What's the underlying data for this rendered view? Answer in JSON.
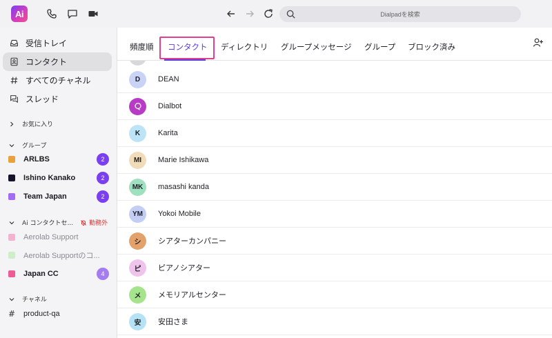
{
  "app": {
    "logo_text": "Ai",
    "accent": "#7b3ff2"
  },
  "topbar": {
    "icons": [
      "phone-icon",
      "chat-icon",
      "video-icon",
      "back-arrow-icon",
      "forward-arrow-icon",
      "refresh-icon"
    ],
    "search_placeholder": "Dialpadを検索"
  },
  "sidebar": {
    "nav": [
      {
        "label": "受信トレイ",
        "icon": "inbox-icon"
      },
      {
        "label": "コンタクト",
        "icon": "contact-icon",
        "active": true
      },
      {
        "label": "すべてのチャネル",
        "icon": "hash-icon"
      },
      {
        "label": "スレッド",
        "icon": "thread-icon"
      }
    ],
    "favorites_label": "お気に入り",
    "groups_label": "グループ",
    "groups": [
      {
        "name": "ARLBS",
        "color": "#e9a23b",
        "badge": "2"
      },
      {
        "name": "Ishino Kanako",
        "color": "#15122b",
        "badge": "2"
      },
      {
        "name": "Team Japan",
        "color": "#a46cf5",
        "badge": "2"
      }
    ],
    "ai_section_label": "Ai コンタクトセ...",
    "ai_status": "勤務外",
    "ai_items": [
      {
        "name": "Aerolab Support",
        "color": "#f3b3cf"
      },
      {
        "name": "Aerolab Supportのコ...",
        "color": "#cdeec6"
      },
      {
        "name": "Japan CC",
        "color": "#ee5c97",
        "badge": "4"
      }
    ],
    "channels_label": "チャネル",
    "channels": [
      {
        "name": "product-qa"
      }
    ]
  },
  "tabs": {
    "items": [
      "頻度順",
      "コンタクト",
      "ディレクトリ",
      "グループメッセージ",
      "グループ",
      "ブロック済み"
    ],
    "active_index": 1
  },
  "contacts": [
    {
      "initials": "D",
      "name": "DEAN",
      "color": "#c9d3f5"
    },
    {
      "initials": "",
      "name": "Dialbot",
      "color": "#b83bc6",
      "icon": "bot-icon"
    },
    {
      "initials": "K",
      "name": "Karita",
      "color": "#bde3f7"
    },
    {
      "initials": "MI",
      "name": "Marie Ishikawa",
      "color": "#f1dcb9"
    },
    {
      "initials": "MK",
      "name": "masashi kanda",
      "color": "#9fe0c1"
    },
    {
      "initials": "YM",
      "name": "Yokoi Mobile",
      "color": "#c4cdf3"
    },
    {
      "initials": "シ",
      "name": "シアターカンパニー",
      "color": "#e3a26c"
    },
    {
      "initials": "ピ",
      "name": "ピアノシアター",
      "color": "#efc4ec"
    },
    {
      "initials": "メ",
      "name": "メモリアルセンター",
      "color": "#a5e38c"
    },
    {
      "initials": "安",
      "name": "安田さま",
      "color": "#b6e2f6"
    }
  ]
}
